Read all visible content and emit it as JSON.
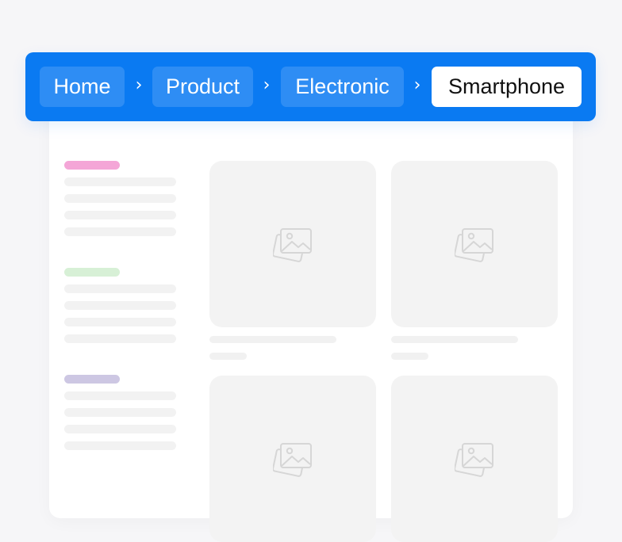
{
  "breadcrumb": {
    "items": [
      {
        "label": "Home",
        "active": false
      },
      {
        "label": "Product",
        "active": false
      },
      {
        "label": "Electronic",
        "active": false
      },
      {
        "label": "Smartphone",
        "active": true
      }
    ],
    "separator": "›"
  },
  "colors": {
    "breadcrumb_bg": "#0a7af2",
    "crumb_active_bg": "#ffffff",
    "crumb_active_text": "#111111",
    "filter_accent_pink": "#f4a6d7",
    "filter_accent_green": "#d7f0d6",
    "filter_accent_purple": "#cdc7e3"
  },
  "icons": {
    "tile_placeholder": "image-placeholder-icon",
    "separator": "chevron-right-icon"
  }
}
